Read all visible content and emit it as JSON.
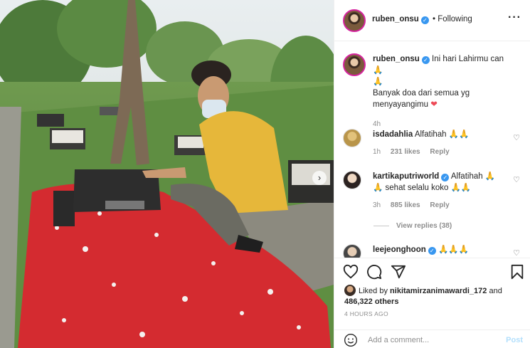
{
  "header": {
    "username": "ruben_onsu",
    "separator": "•",
    "follow_label": "Following",
    "more_icon": "more-dots-icon"
  },
  "caption": {
    "username": "ruben_onsu",
    "line1": "Ini hari Lahirmu can",
    "line2": "Banyak doa dari semua yg menyayangimu",
    "age": "4h"
  },
  "comments": [
    {
      "username": "isdadahlia",
      "text": "Alfatihah",
      "age": "1h",
      "likes": "231 likes",
      "reply": "Reply"
    },
    {
      "username": "kartikaputriworld",
      "text_a": "Alfatihah",
      "text_b": "sehat selalu koko",
      "age": "3h",
      "likes": "885 likes",
      "reply": "Reply"
    },
    {
      "username": "leejeonghoon",
      "text": ""
    }
  ],
  "view_replies": "View replies (38)",
  "likes": {
    "prefix": "Liked by",
    "user": "nikitamirzanimawardi_172",
    "and": "and",
    "count": "486,322 others"
  },
  "timestamp": "4 HOURS AGO",
  "comment_box": {
    "placeholder": "Add a comment...",
    "post_label": "Post"
  },
  "colors": {
    "verified": "#3897f0",
    "heart": "#ed4956",
    "post_disabled": "#b2dffc",
    "meta": "#8e8e8e"
  }
}
